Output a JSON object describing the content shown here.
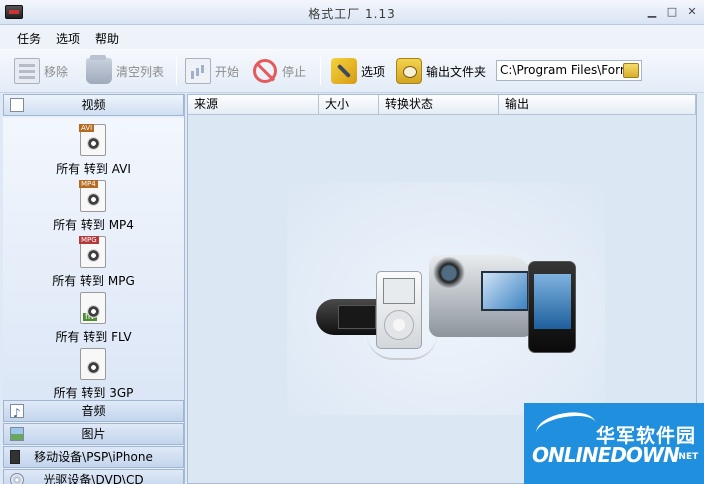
{
  "window": {
    "title": "格式工厂  1.13",
    "controls": {
      "minimize": "▁",
      "maximize": "□",
      "close": "✕"
    }
  },
  "menu": {
    "items": [
      "任务",
      "选项",
      "帮助"
    ]
  },
  "toolbar": {
    "remove_label": "移除",
    "clear_label": "清空列表",
    "start_label": "开始",
    "stop_label": "停止",
    "options_label": "选项",
    "output_label": "输出文件夹",
    "output_path": "C:\\Program Files\\Form."
  },
  "sidebar": {
    "categories": [
      "视频",
      "音频",
      "图片",
      "移动设备\\PSP\\iPhone",
      "光驱设备\\DVD\\CD"
    ],
    "video_items": [
      {
        "tag": "AVI",
        "label": "所有 转到 AVI"
      },
      {
        "tag": "MP4",
        "label": "所有 转到 MP4"
      },
      {
        "tag": "MPG",
        "label": "所有 转到 MPG"
      },
      {
        "tag": "flv",
        "label": "所有 转到 FLV"
      },
      {
        "tag": "",
        "label": "所有 转到 3GP"
      }
    ]
  },
  "filelist": {
    "columns": [
      "来源",
      "大小",
      "转换状态",
      "输出"
    ]
  },
  "watermark": {
    "cn": "华军软件园",
    "en": "ONLINEDOWN",
    "net": ".NET"
  }
}
